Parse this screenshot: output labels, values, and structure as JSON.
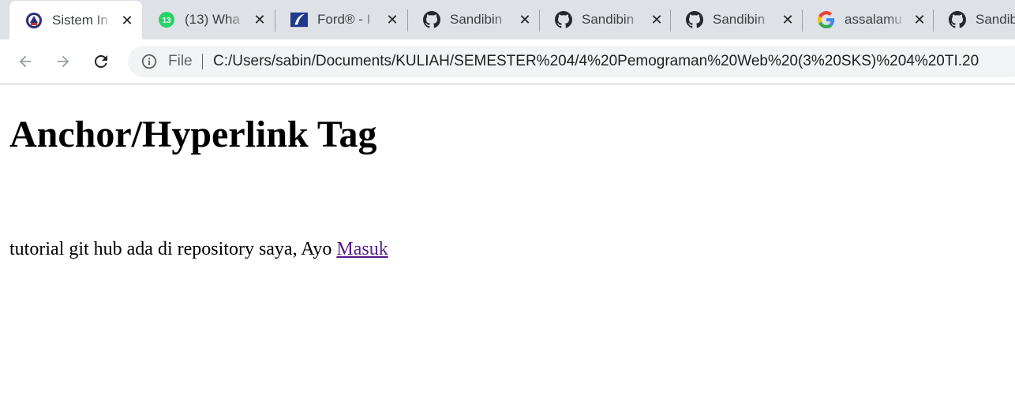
{
  "tabs": [
    {
      "title": "Sistem In",
      "icon": "university-logo-icon",
      "active": true
    },
    {
      "title": "(13) Wha",
      "icon": "whatsapp-icon",
      "badge": "13"
    },
    {
      "title": "Ford® - I",
      "icon": "ford-logo-icon"
    },
    {
      "title": "Sandibin",
      "icon": "github-icon"
    },
    {
      "title": "Sandibin",
      "icon": "github-icon"
    },
    {
      "title": "Sandibin",
      "icon": "github-icon"
    },
    {
      "title": "assalamu",
      "icon": "google-icon"
    },
    {
      "title": "Sandib",
      "icon": "github-icon"
    }
  ],
  "toolbar": {
    "scheme_label": "File",
    "url": "C:/Users/sabin/Documents/KULIAH/SEMESTER%204/4%20Pemograman%20Web%20(3%20SKS)%204%20TI.20"
  },
  "page": {
    "heading": "Anchor/Hyperlink Tag",
    "text": "tutorial git hub ada di repository saya, Ayo ",
    "link_text": "Masuk"
  },
  "colors": {
    "tabbar_bg": "#dee1e6",
    "link_visited": "#551a8b",
    "whatsapp": "#25d366",
    "ford_blue": "#1f3a8a"
  }
}
